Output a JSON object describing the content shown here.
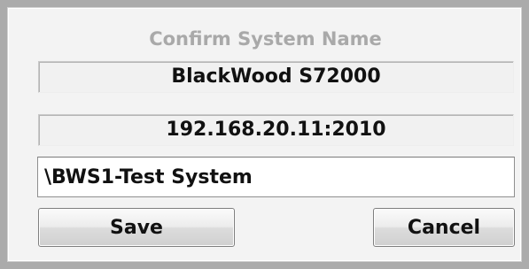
{
  "dialog": {
    "title": "Confirm System Name",
    "device_model": "BlackWood S72000",
    "address": "192.168.20.11:2010",
    "system_name_value": "\\BWS1-Test System",
    "save_label": "Save",
    "cancel_label": "Cancel"
  }
}
